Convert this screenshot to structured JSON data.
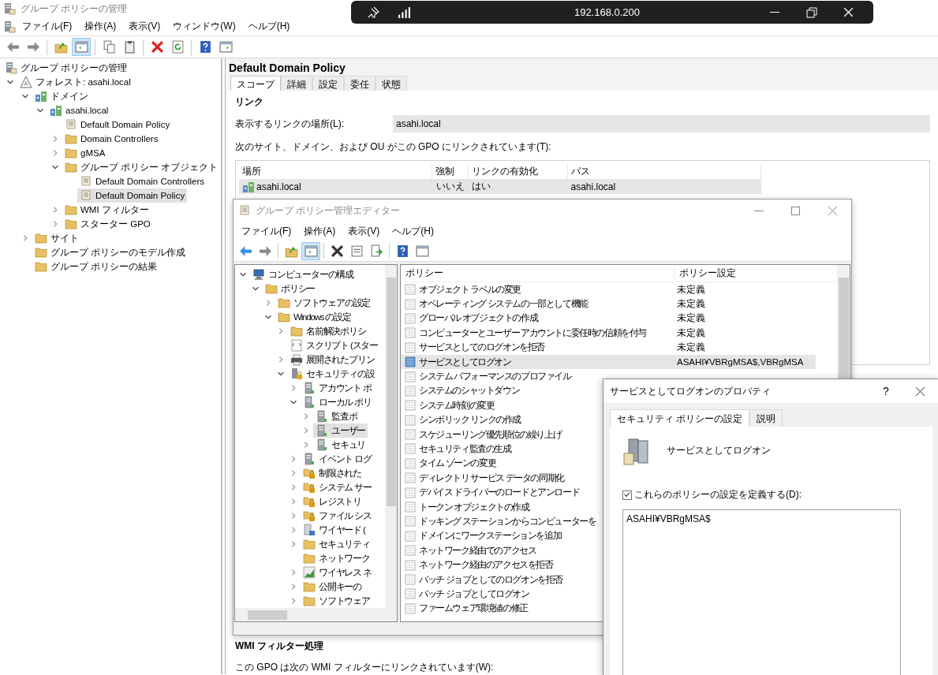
{
  "main_window": {
    "title": "グループ ポリシーの管理",
    "menu": [
      "ファイル(F)",
      "操作(A)",
      "表示(V)",
      "ウィンドウ(W)",
      "ヘルプ(H)"
    ],
    "toolbar": {
      "console_tree_shown": true
    }
  },
  "remote_bar": {
    "address": "192.168.0.200"
  },
  "console_tree": [
    {
      "label": "グループ ポリシーの管理",
      "kind": "app",
      "selected": false,
      "children": [
        {
          "label": "フォレスト: asahi.local",
          "kind": "forest",
          "expanded": true,
          "selected": false,
          "children": [
            {
              "label": "ドメイン",
              "kind": "domain",
              "expanded": true,
              "selected": false,
              "children": [
                {
                  "label": "asahi.local",
                  "kind": "domain",
                  "expanded": true,
                  "selected": false,
                  "children": [
                    {
                      "label": "Default Domain Policy",
                      "kind": "policy",
                      "selected": false
                    },
                    {
                      "label": "Domain Controllers",
                      "kind": "folder",
                      "expanded": false,
                      "selected": false
                    },
                    {
                      "label": "gMSA",
                      "kind": "folder",
                      "expanded": false,
                      "selected": false
                    },
                    {
                      "label": "グループ ポリシー オブジェクト",
                      "kind": "folder",
                      "expanded": true,
                      "selected": false,
                      "children": [
                        {
                          "label": "Default Domain Controllers",
                          "kind": "policy",
                          "selected": false
                        },
                        {
                          "label": "Default Domain Policy",
                          "kind": "policy",
                          "selected": true
                        }
                      ]
                    },
                    {
                      "label": "WMI フィルター",
                      "kind": "folder",
                      "expanded": false,
                      "selected": false
                    },
                    {
                      "label": "スターター GPO",
                      "kind": "folder",
                      "expanded": false,
                      "selected": false
                    }
                  ]
                }
              ]
            },
            {
              "label": "サイト",
              "kind": "folder",
              "expanded": false,
              "selected": false
            },
            {
              "label": "グループ ポリシーのモデル作成",
              "kind": "folder",
              "selected": false
            },
            {
              "label": "グループ ポリシーの結果",
              "kind": "folder",
              "selected": false
            }
          ]
        }
      ]
    }
  ],
  "details": {
    "title": "Default Domain Policy",
    "tabs": [
      {
        "label": "スコープ",
        "selected": true
      },
      {
        "label": "詳細",
        "selected": false
      },
      {
        "label": "設定",
        "selected": false
      },
      {
        "label": "委任",
        "selected": false
      },
      {
        "label": "状態",
        "selected": false
      }
    ],
    "links_heading": "リンク",
    "location_label": "表示するリンクの場所(L):",
    "location_value": "asahi.local",
    "links_caption": "次のサイト、ドメイン、および OU がこの GPO にリンクされています(T):",
    "links_table": {
      "columns": [
        "場所",
        "強制",
        "リンクの有効化",
        "パス"
      ],
      "rows": [
        {
          "cells": [
            "asahi.local",
            "いいえ",
            "はい",
            "asahi.local"
          ],
          "selected": true
        }
      ]
    },
    "wmi_heading": "WMI フィルター処理",
    "wmi_caption": "この GPO は次の WMI フィルターにリンクされています(W):"
  },
  "editor_window": {
    "title": "グループ ポリシー管理エディター",
    "menu": [
      "ファイル(F)",
      "操作(A)",
      "表示(V)",
      "ヘルプ(H)"
    ],
    "toolbar": {
      "console_tree_shown": true
    },
    "tree": [
      {
        "label": "コンピューターの構成",
        "kind": "computer",
        "expanded": true,
        "selected": false,
        "children": [
          {
            "label": "ポリシー",
            "kind": "folder",
            "expanded": true,
            "selected": false,
            "children": [
              {
                "label": "ソフトウェアの設定",
                "kind": "folder",
                "expanded": false,
                "selected": false
              },
              {
                "label": "Windows の設定",
                "kind": "folder",
                "expanded": true,
                "selected": false,
                "children": [
                  {
                    "label": "名前解決ポリシ",
                    "kind": "folder",
                    "expanded": false,
                    "selected": false
                  },
                  {
                    "label": "スクリプト (スター",
                    "kind": "script",
                    "selected": false
                  },
                  {
                    "label": "展開されたプリン",
                    "kind": "printer",
                    "expanded": false,
                    "selected": false
                  },
                  {
                    "label": "セキュリティの設",
                    "kind": "secure-server",
                    "expanded": true,
                    "selected": false,
                    "children": [
                      {
                        "label": "アカウント ポ",
                        "kind": "server",
                        "expanded": false,
                        "selected": false
                      },
                      {
                        "label": "ローカル ポリ",
                        "kind": "server",
                        "expanded": true,
                        "selected": false,
                        "children": [
                          {
                            "label": "監査ポ",
                            "kind": "server",
                            "expanded": false,
                            "selected": false
                          },
                          {
                            "label": "ユーザー",
                            "kind": "server",
                            "expanded": false,
                            "selected": true
                          },
                          {
                            "label": "セキュリ",
                            "kind": "server",
                            "expanded": false,
                            "selected": false
                          }
                        ]
                      },
                      {
                        "label": "イベント ログ",
                        "kind": "server",
                        "expanded": false,
                        "selected": false
                      },
                      {
                        "label": "制限された",
                        "kind": "lock-folder",
                        "expanded": false,
                        "selected": false
                      },
                      {
                        "label": "システム サー",
                        "kind": "lock-folder",
                        "expanded": false,
                        "selected": false
                      },
                      {
                        "label": "レジストリ",
                        "kind": "lock-folder",
                        "expanded": false,
                        "selected": false
                      },
                      {
                        "label": "ファイル シス",
                        "kind": "lock-folder",
                        "expanded": false,
                        "selected": false
                      },
                      {
                        "label": "ワイヤード (",
                        "kind": "wired",
                        "expanded": false,
                        "selected": false
                      },
                      {
                        "label": "セキュリティ",
                        "kind": "folder",
                        "expanded": false,
                        "selected": false
                      },
                      {
                        "label": "ネットワーク",
                        "kind": "folder",
                        "selected": false
                      },
                      {
                        "label": "ワイヤレス ネ",
                        "kind": "wireless",
                        "expanded": false,
                        "selected": false
                      },
                      {
                        "label": "公開キーの",
                        "kind": "folder",
                        "expanded": false,
                        "selected": false
                      },
                      {
                        "label": "ソフトウェア",
                        "kind": "folder",
                        "expanded": false,
                        "selected": false
                      }
                    ]
                  }
                ]
              }
            ]
          }
        ]
      }
    ],
    "policy_list": {
      "columns": [
        "ポリシー",
        "ポリシー設定"
      ],
      "rows": [
        {
          "name": "オブジェクト ラベルの変更",
          "setting": "未定義",
          "selected": false
        },
        {
          "name": "オペレーティング システムの一部として機能",
          "setting": "未定義",
          "selected": false
        },
        {
          "name": "グローバル オブジェクトの作成",
          "setting": "未定義",
          "selected": false
        },
        {
          "name": "コンピューターとユーザー アカウントに委任時の信頼を付与",
          "setting": "未定義",
          "selected": false
        },
        {
          "name": "サービスとしてのログオンを拒否",
          "setting": "未定義",
          "selected": false
        },
        {
          "name": "サービスとしてログオン",
          "setting": "ASAHI¥VBRgMSA$,VBRgMSA",
          "selected": true
        },
        {
          "name": "システム パフォーマンスのプロファイル",
          "selected": false
        },
        {
          "name": "システムのシャットダウン",
          "selected": false
        },
        {
          "name": "システム時刻の変更",
          "selected": false
        },
        {
          "name": "シンボリック リンクの作成",
          "selected": false
        },
        {
          "name": "スケジューリング優先順位の繰り上げ",
          "selected": false
        },
        {
          "name": "セキュリティ監査の生成",
          "selected": false
        },
        {
          "name": "タイム ゾーンの変更",
          "selected": false
        },
        {
          "name": "ディレクトリ サービス データの同期化",
          "selected": false
        },
        {
          "name": "デバイス ドライバーのロードとアンロード",
          "selected": false
        },
        {
          "name": "トークン オブジェクトの作成",
          "selected": false
        },
        {
          "name": "ドッキング ステーションからコンピューターを",
          "selected": false
        },
        {
          "name": "ドメインにワークステーションを追加",
          "selected": false
        },
        {
          "name": "ネットワーク経由でのアクセス",
          "selected": false
        },
        {
          "name": "ネットワーク経由のアクセスを拒否",
          "selected": false
        },
        {
          "name": "バッチ ジョブとしてのログオンを拒否",
          "selected": false
        },
        {
          "name": "バッチ ジョブとしてログオン",
          "selected": false
        },
        {
          "name": "ファームウェア環境値の修正",
          "selected": false
        }
      ]
    }
  },
  "properties_dialog": {
    "title": "サービスとしてログオンのプロパティ",
    "help": "?",
    "tabs": [
      {
        "label": "セキュリティ ポリシーの設定",
        "selected": true
      },
      {
        "label": "説明",
        "selected": false
      }
    ],
    "policy_name": "サービスとしてログオン",
    "define_checkbox": {
      "label": "これらのポリシーの設定を定義する(D):",
      "checked": true
    },
    "accounts": [
      "ASAHI¥VBRgMSA$"
    ]
  }
}
